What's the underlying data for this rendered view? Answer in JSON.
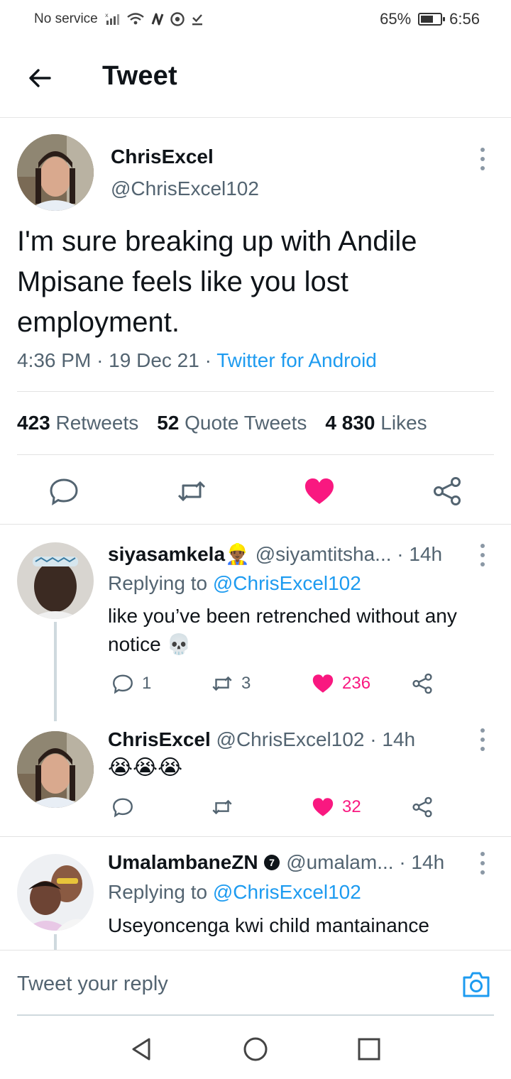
{
  "status_bar": {
    "carrier": "No service",
    "battery": "65%",
    "battery_fraction": 0.65,
    "time": "6:56",
    "icons": [
      "signal-icon",
      "wifi-icon",
      "nfc-icon",
      "chrome-icon",
      "download-done-icon"
    ]
  },
  "header": {
    "title": "Tweet"
  },
  "tweet": {
    "name": "ChrisExcel",
    "handle": "@ChrisExcel102",
    "text": "I'm sure breaking up with Andile Mpisane feels like you lost employment.",
    "time": "4:36 PM",
    "date": "19 Dec 21",
    "source": "Twitter for Android",
    "retweets_count": "423",
    "retweets_label": "Retweets",
    "quotes_count": "52",
    "quotes_label": "Quote Tweets",
    "likes_count": "4 830",
    "likes_label": "Likes"
  },
  "replies": [
    {
      "name": "siyasamkela",
      "name_emoji": "👷🏾‍♂️",
      "handle": "@siyamtitsha...",
      "age": "· 14h",
      "replying_prefix": "Replying to",
      "replying_to": "@ChrisExcel102",
      "text": "like you’ve been retrenched without any notice 💀",
      "reply_count": "1",
      "retweet_count": "3",
      "like_count": "236"
    },
    {
      "name": "ChrisExcel",
      "handle": "@ChrisExcel102",
      "age": "· 14h",
      "text": "😭😭😭",
      "like_count": "32"
    },
    {
      "name": "UmalambaneZN",
      "badge": "7",
      "handle": "@umalam...",
      "age": "· 14h",
      "replying_prefix": "Replying to",
      "replying_to": "@ChrisExcel102",
      "text": "Useyoncenga kwi child mantainance"
    }
  ],
  "reply_bar": {
    "placeholder": "Tweet your reply"
  },
  "colors": {
    "accent": "#1d9bf0",
    "like": "#f91880",
    "text": "#0f1419",
    "muted": "#536471"
  }
}
